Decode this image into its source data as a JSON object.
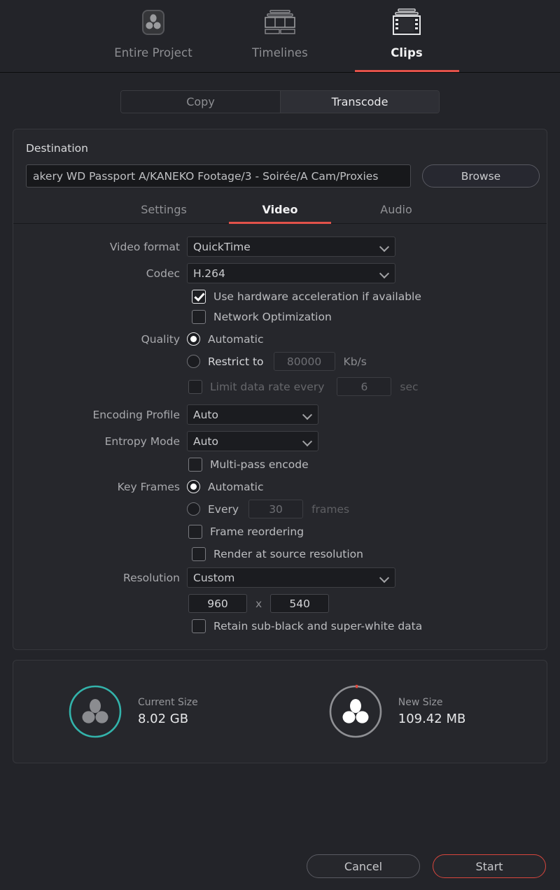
{
  "top_tabs": [
    {
      "label": "Entire Project",
      "icon": "resolve-badge-icon",
      "active": false
    },
    {
      "label": "Timelines",
      "icon": "timeline-stack-icon",
      "active": false
    },
    {
      "label": "Clips",
      "icon": "film-strip-icon",
      "active": true
    }
  ],
  "mode_segment": {
    "copy_label": "Copy",
    "transcode_label": "Transcode",
    "selected": "Transcode"
  },
  "destination": {
    "title": "Destination",
    "path_value": "akery WD Passport A/KANEKO Footage/3 - Soirée/A Cam/Proxies",
    "browse_label": "Browse"
  },
  "sub_tabs": [
    {
      "label": "Settings",
      "active": false
    },
    {
      "label": "Video",
      "active": true
    },
    {
      "label": "Audio",
      "active": false
    }
  ],
  "video": {
    "video_format_label": "Video format",
    "video_format_value": "QuickTime",
    "codec_label": "Codec",
    "codec_value": "H.264",
    "hw_accel_label": "Use hardware acceleration if available",
    "hw_accel_checked": true,
    "network_opt_label": "Network Optimization",
    "network_opt_checked": false,
    "quality_label": "Quality",
    "quality_automatic_label": "Automatic",
    "quality_restrict_label": "Restrict to",
    "quality_restrict_value": "80000",
    "quality_restrict_unit": "Kb/s",
    "quality_selected": "Automatic",
    "limit_rate_label": "Limit data rate every",
    "limit_rate_value": "6",
    "limit_rate_unit": "sec",
    "limit_rate_checked": false,
    "encoding_profile_label": "Encoding Profile",
    "encoding_profile_value": "Auto",
    "entropy_mode_label": "Entropy Mode",
    "entropy_mode_value": "Auto",
    "multipass_label": "Multi-pass encode",
    "multipass_checked": false,
    "keyframes_label": "Key Frames",
    "keyframes_automatic_label": "Automatic",
    "keyframes_every_label": "Every",
    "keyframes_every_value": "30",
    "keyframes_every_unit": "frames",
    "keyframes_selected": "Automatic",
    "frame_reordering_label": "Frame reordering",
    "frame_reordering_checked": false,
    "render_source_res_label": "Render at source resolution",
    "render_source_res_checked": false,
    "resolution_label": "Resolution",
    "resolution_value": "Custom",
    "resolution_width": "960",
    "resolution_x": "x",
    "resolution_height": "540",
    "retain_subblack_label": "Retain sub-black and super-white data",
    "retain_subblack_checked": false
  },
  "summary": {
    "current": {
      "label": "Current Size",
      "value": "8.02 GB",
      "ring_color": "#33b3ab"
    },
    "new": {
      "label": "New Size",
      "value": "109.42 MB",
      "ring_color": "#8f9094",
      "progress_color": "#e2473c"
    }
  },
  "footer": {
    "cancel_label": "Cancel",
    "start_label": "Start"
  },
  "colors": {
    "accent_red": "#e2524a",
    "teal": "#33b3ab",
    "background": "#232429",
    "panel": "#26272c"
  }
}
